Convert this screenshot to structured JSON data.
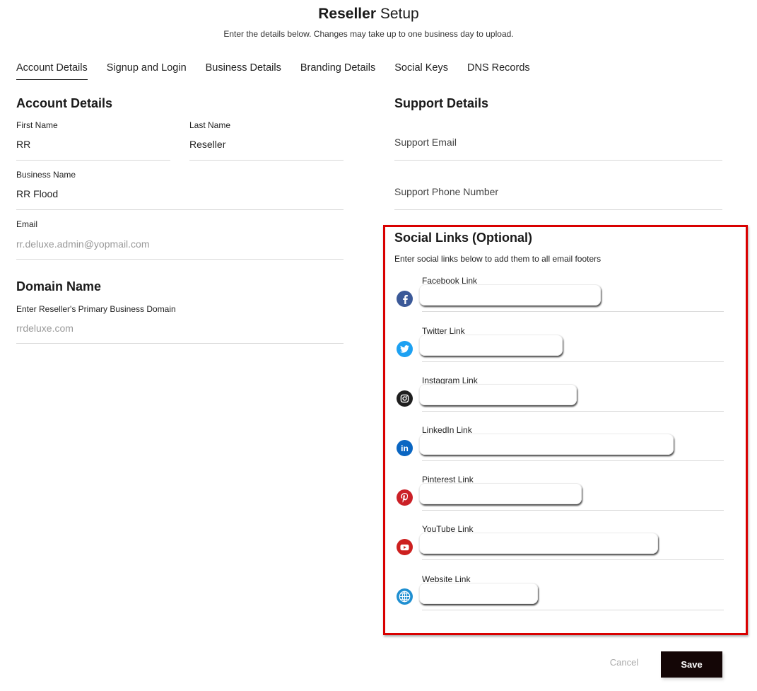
{
  "header": {
    "title_bold": "Reseller",
    "title_rest": " Setup",
    "subtitle": "Enter the details below. Changes may take up to one business day to upload."
  },
  "tabs": [
    {
      "label": "Account Details",
      "active": true
    },
    {
      "label": "Signup and Login",
      "active": false
    },
    {
      "label": "Business Details",
      "active": false
    },
    {
      "label": "Branding Details",
      "active": false
    },
    {
      "label": "Social Keys",
      "active": false
    },
    {
      "label": "DNS Records",
      "active": false
    }
  ],
  "account": {
    "title": "Account Details",
    "first_name_label": "First Name",
    "first_name_value": "RR",
    "last_name_label": "Last Name",
    "last_name_value": "Reseller",
    "business_name_label": "Business Name",
    "business_name_value": "RR Flood",
    "email_label": "Email",
    "email_value": "rr.deluxe.admin@yopmail.com"
  },
  "domain": {
    "title": "Domain Name",
    "label": "Enter Reseller's Primary Business Domain",
    "value": "rrdeluxe.com"
  },
  "support": {
    "title": "Support Details",
    "email_placeholder": "Support Email",
    "phone_placeholder": "Support Phone Number"
  },
  "social": {
    "title": "Social Links (Optional)",
    "description": "Enter social links below to add them to all email footers",
    "links": [
      {
        "label": "Facebook Link",
        "icon": "facebook-icon",
        "color": "#3b5998",
        "glyph": "f"
      },
      {
        "label": "Twitter Link",
        "icon": "twitter-icon",
        "color": "#1da1f2",
        "glyph": ""
      },
      {
        "label": "Instagram Link",
        "icon": "instagram-icon",
        "color": "#1f1f1f",
        "glyph": ""
      },
      {
        "label": "LinkedIn Link",
        "icon": "linkedin-icon",
        "color": "#0a66c2",
        "glyph": "in"
      },
      {
        "label": "Pinterest Link",
        "icon": "pinterest-icon",
        "color": "#cb2027",
        "glyph": "P"
      },
      {
        "label": "YouTube Link",
        "icon": "youtube-icon",
        "color": "#cd201f",
        "glyph": ""
      },
      {
        "label": "Website Link",
        "icon": "globe-icon",
        "color": "#1f8fd1",
        "glyph": ""
      }
    ]
  },
  "actions": {
    "cancel_label": "Cancel",
    "save_label": "Save"
  },
  "colors": {
    "highlight_border": "#d90000",
    "save_button_bg": "#140606"
  }
}
